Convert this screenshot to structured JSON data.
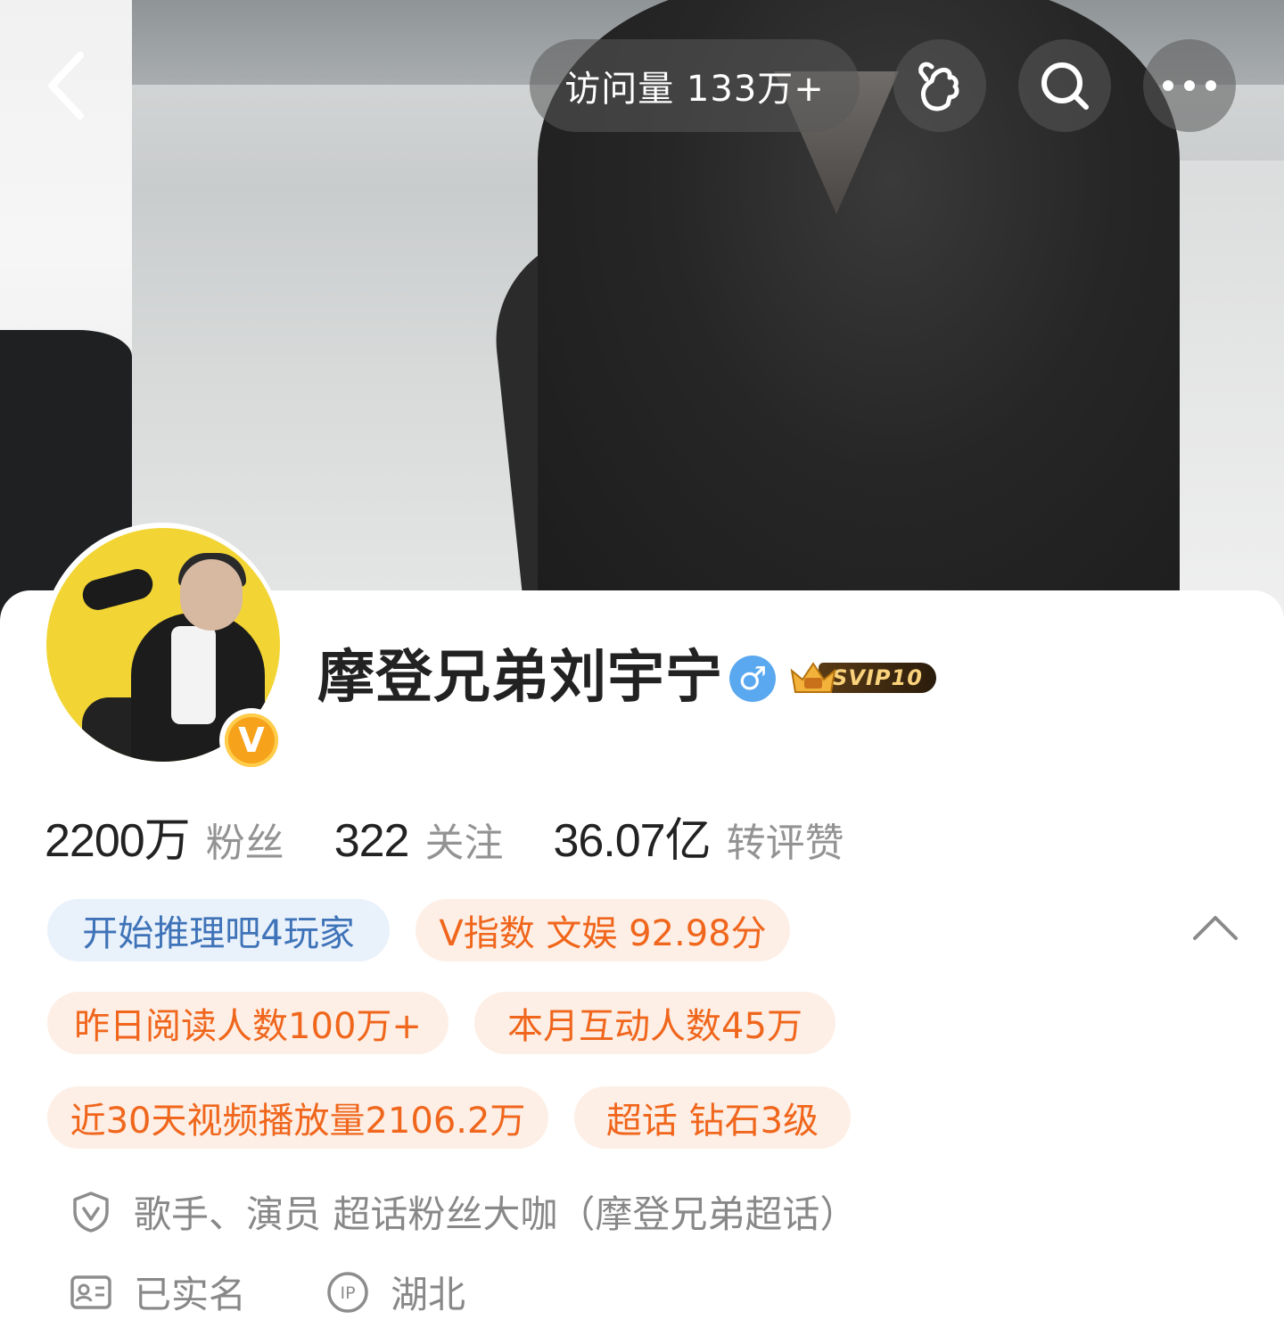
{
  "header": {
    "visits_label": "访问量 133万+",
    "icons": [
      "back-chevron-icon",
      "finger-heart-icon",
      "search-icon",
      "more-icon"
    ]
  },
  "profile": {
    "name": "摩登兄弟刘宇宁",
    "gender_symbol": "♂",
    "verified_badge": "V",
    "svip_label": "SVIP10"
  },
  "stats": [
    {
      "value": "2200万",
      "label": "粉丝"
    },
    {
      "value": "322",
      "label": "关注"
    },
    {
      "value": "36.07亿",
      "label": "转评赞"
    }
  ],
  "tags": {
    "row1": [
      "开始推理吧4玩家",
      "V指数 文娱 92.98分"
    ],
    "row2": [
      "昨日阅读人数100万+",
      "本月互动人数45万"
    ],
    "row3": [
      "近30天视频播放量2106.2万",
      "超话 钻石3级"
    ]
  },
  "info": {
    "verification": "歌手、演员 超话粉丝大咖（摩登兄弟超话）",
    "real_name": "已实名",
    "ip_location": "湖北"
  },
  "colors": {
    "tag_blue_bg": "#e9f1fb",
    "tag_blue_text": "#3f73b8",
    "tag_orange_bg": "#fdefe6",
    "tag_orange_text": "#f0661c",
    "gender_blue": "#5aa8ef",
    "verified_orange": "#f7a21b"
  }
}
